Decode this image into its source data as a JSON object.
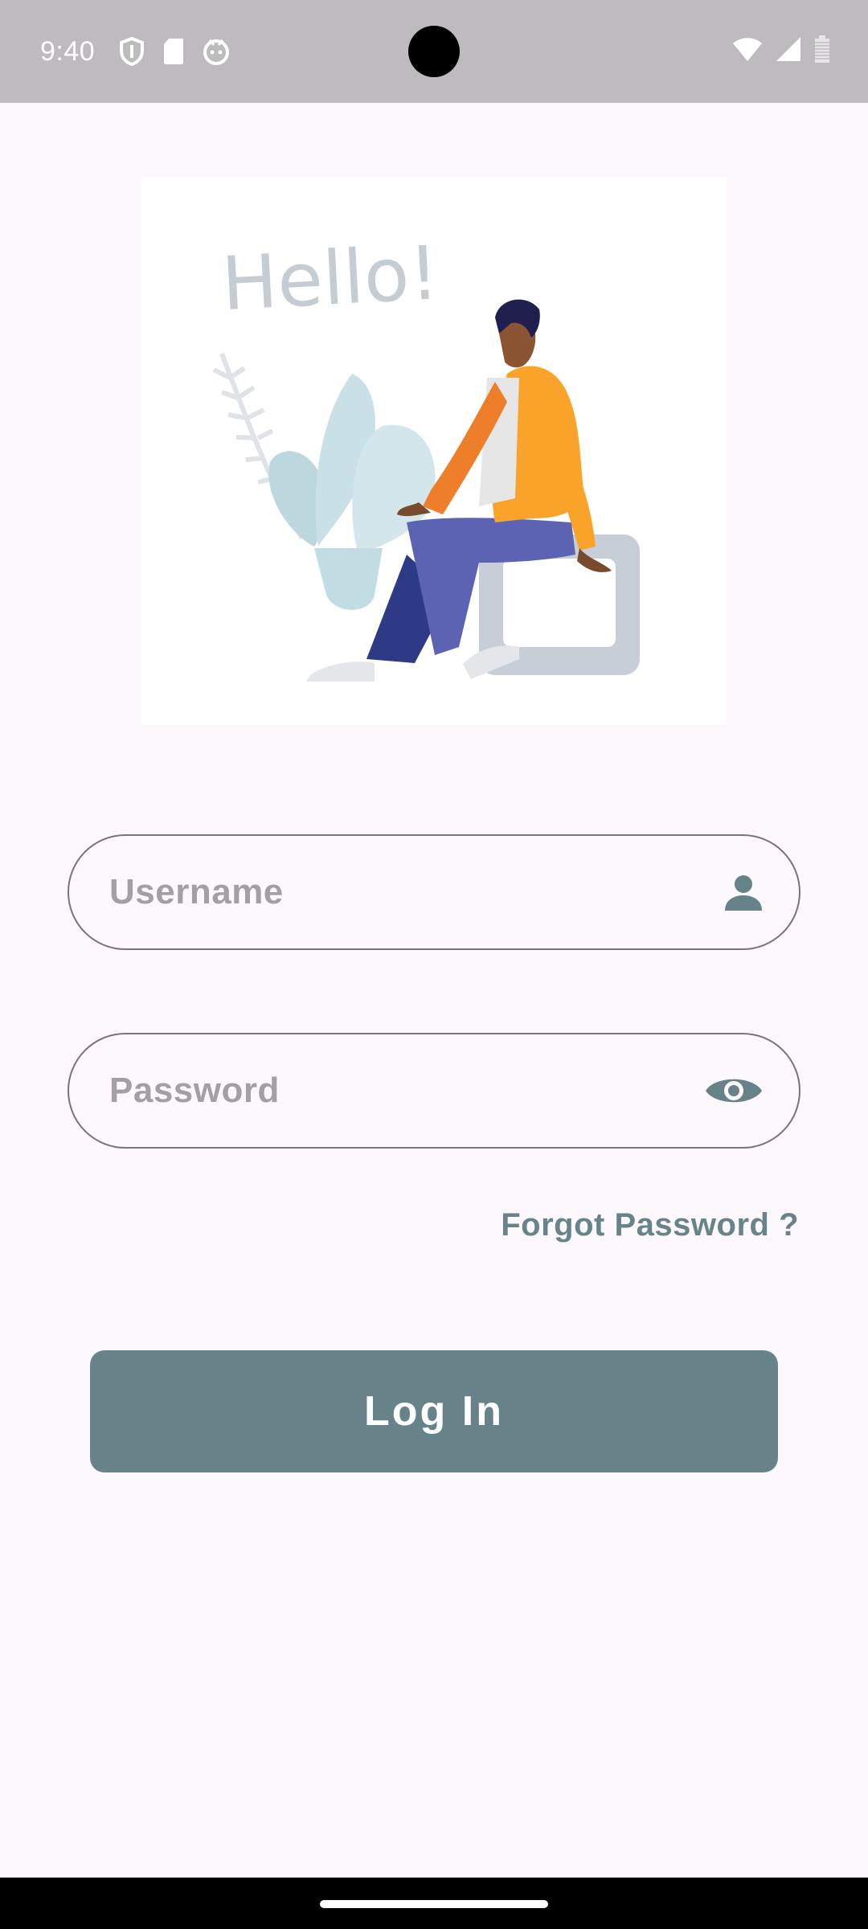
{
  "status_bar": {
    "time": "9:40",
    "left_icons": [
      "shield-icon",
      "sd-card-icon",
      "face-icon"
    ],
    "right_icons": [
      "wifi-icon",
      "signal-icon",
      "battery-icon"
    ]
  },
  "hero": {
    "greeting_text": "Hello!",
    "image": "person-sitting-illustration"
  },
  "form": {
    "username_placeholder": "Username",
    "username_value": "",
    "username_icon": "person-icon",
    "password_placeholder": "Password",
    "password_value": "",
    "password_icon": "eye-icon",
    "forgot_label": "Forgot Password ?",
    "login_label": "Log In"
  },
  "colors": {
    "accent": "#678389",
    "link": "#66848a",
    "background": "#fdf8fb",
    "status_bar": "#bdbbbd"
  }
}
